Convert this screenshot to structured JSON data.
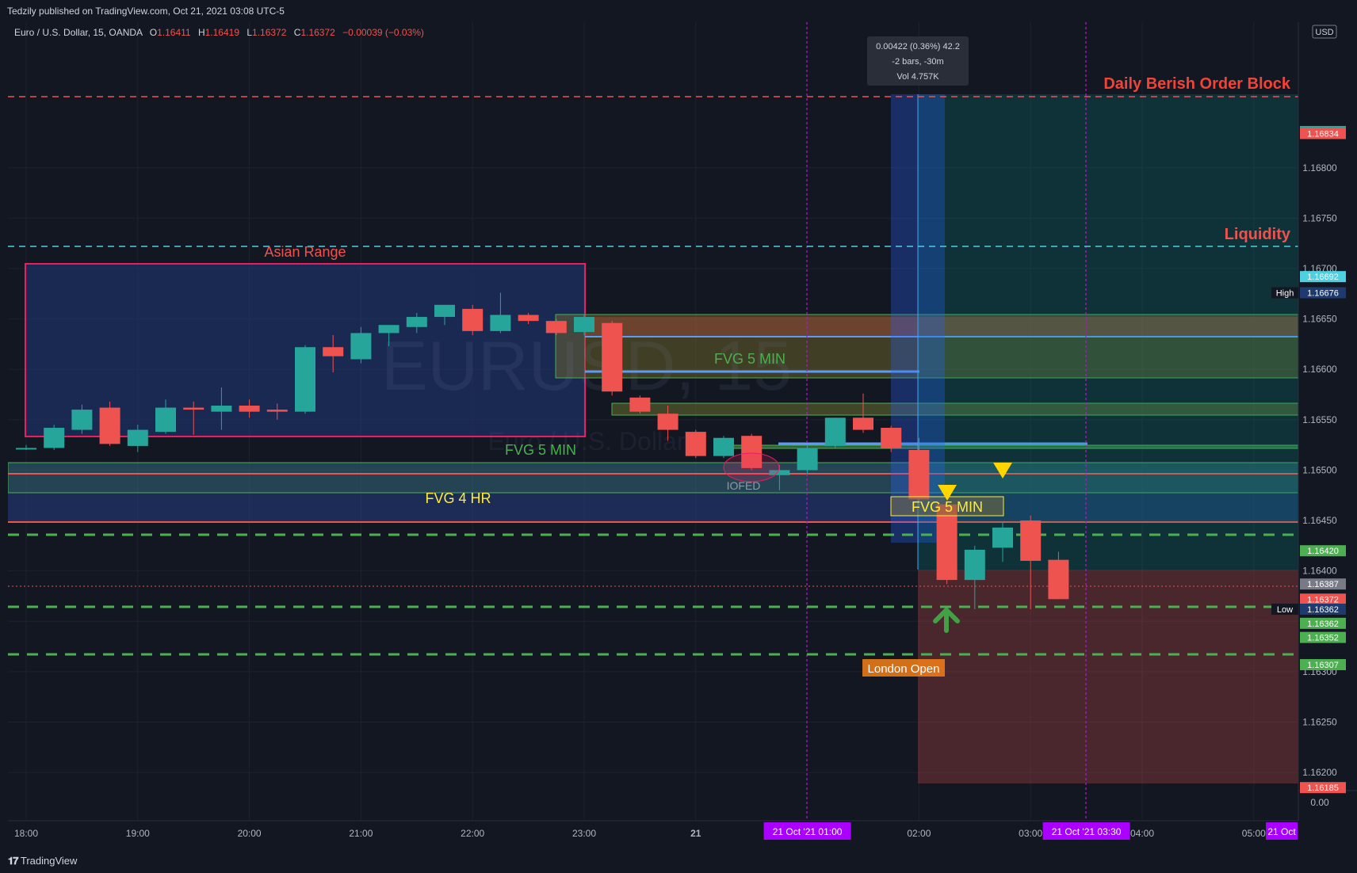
{
  "header": {
    "publish_text": "Tedzily published on TradingView.com, Oct 21, 2021 03:08 UTC-5"
  },
  "footer": {
    "brand": "TradingView"
  },
  "legend": {
    "symbol": "Euro / U.S. Dollar, 15, OANDA",
    "o_label": "O",
    "o_value": "1.16411",
    "h_label": "H",
    "h_value": "1.16419",
    "l_label": "L",
    "l_value": "1.16372",
    "c_label": "C",
    "c_value": "1.16372",
    "change": "−0.00039 (−0.03%)"
  },
  "watermark": "EURUSD, 15",
  "watermark_sub": "Euro / U.S. Dollar",
  "colors": {
    "bull": "#26a69a",
    "bear": "#ef5350",
    "background": "#131722"
  },
  "chart_data": {
    "type": "candlestick",
    "symbol": "EURUSD",
    "timeframe": "15",
    "currency": "USD",
    "ylim": [
      1.1616,
      1.1688
    ],
    "y_ticks": [
      "1.16800",
      "1.16750",
      "1.16700",
      "1.16650",
      "1.16600",
      "1.16550",
      "1.16500",
      "1.16450",
      "1.16400",
      "1.16350",
      "1.16300",
      "1.16250",
      "1.16200",
      "0.00"
    ],
    "x_ticks": [
      {
        "label": "18:00",
        "t": 0
      },
      {
        "label": "19:00",
        "t": 4
      },
      {
        "label": "20:00",
        "t": 8
      },
      {
        "label": "21:00",
        "t": 12
      },
      {
        "label": "22:00",
        "t": 16
      },
      {
        "label": "23:00",
        "t": 20
      },
      {
        "label": "21",
        "t": 24
      },
      {
        "label": "02:00",
        "t": 32
      },
      {
        "label": "03:00",
        "t": 36
      },
      {
        "label": "04:00",
        "t": 40
      },
      {
        "label": "05:00",
        "t": 44
      }
    ],
    "candles": [
      {
        "t": 0,
        "o": 1.16522,
        "h": 1.16525,
        "l": 1.1652,
        "c": 1.16522
      },
      {
        "t": 1,
        "o": 1.16522,
        "h": 1.16545,
        "l": 1.1652,
        "c": 1.16542
      },
      {
        "t": 2,
        "o": 1.1654,
        "h": 1.16565,
        "l": 1.16536,
        "c": 1.1656
      },
      {
        "t": 3,
        "o": 1.16562,
        "h": 1.16568,
        "l": 1.16524,
        "c": 1.16526
      },
      {
        "t": 4,
        "o": 1.16524,
        "h": 1.16545,
        "l": 1.16518,
        "c": 1.1654
      },
      {
        "t": 5,
        "o": 1.16538,
        "h": 1.1657,
        "l": 1.16536,
        "c": 1.16562
      },
      {
        "t": 6,
        "o": 1.16562,
        "h": 1.16568,
        "l": 1.16535,
        "c": 1.1656
      },
      {
        "t": 7,
        "o": 1.16558,
        "h": 1.16582,
        "l": 1.1654,
        "c": 1.16564
      },
      {
        "t": 8,
        "o": 1.16564,
        "h": 1.1657,
        "l": 1.16552,
        "c": 1.16558
      },
      {
        "t": 9,
        "o": 1.1656,
        "h": 1.16566,
        "l": 1.1655,
        "c": 1.16558
      },
      {
        "t": 10,
        "o": 1.16558,
        "h": 1.16624,
        "l": 1.16556,
        "c": 1.16622
      },
      {
        "t": 11,
        "o": 1.16622,
        "h": 1.16634,
        "l": 1.16597,
        "c": 1.16613
      },
      {
        "t": 12,
        "o": 1.1661,
        "h": 1.16642,
        "l": 1.16606,
        "c": 1.16636
      },
      {
        "t": 13,
        "o": 1.16636,
        "h": 1.16642,
        "l": 1.16623,
        "c": 1.16644
      },
      {
        "t": 14,
        "o": 1.16642,
        "h": 1.16656,
        "l": 1.16636,
        "c": 1.16652
      },
      {
        "t": 15,
        "o": 1.16652,
        "h": 1.16662,
        "l": 1.16644,
        "c": 1.16664
      },
      {
        "t": 16,
        "o": 1.1666,
        "h": 1.16664,
        "l": 1.16634,
        "c": 1.16638
      },
      {
        "t": 17,
        "o": 1.16638,
        "h": 1.16676,
        "l": 1.16636,
        "c": 1.16654
      },
      {
        "t": 18,
        "o": 1.16654,
        "h": 1.16656,
        "l": 1.16645,
        "c": 1.16648
      },
      {
        "t": 19,
        "o": 1.16648,
        "h": 1.1665,
        "l": 1.16634,
        "c": 1.16636
      },
      {
        "t": 20,
        "o": 1.16637,
        "h": 1.16654,
        "l": 1.16634,
        "c": 1.16652
      },
      {
        "t": 21,
        "o": 1.16646,
        "h": 1.16648,
        "l": 1.16574,
        "c": 1.16578
      },
      {
        "t": 22,
        "o": 1.16572,
        "h": 1.16574,
        "l": 1.16556,
        "c": 1.16558
      },
      {
        "t": 23,
        "o": 1.16556,
        "h": 1.16564,
        "l": 1.16529,
        "c": 1.1654
      },
      {
        "t": 24,
        "o": 1.16538,
        "h": 1.1654,
        "l": 1.16512,
        "c": 1.16514
      },
      {
        "t": 25,
        "o": 1.16514,
        "h": 1.16534,
        "l": 1.16512,
        "c": 1.16532
      },
      {
        "t": 26,
        "o": 1.16534,
        "h": 1.16536,
        "l": 1.165,
        "c": 1.16502
      },
      {
        "t": 27,
        "o": 1.16495,
        "h": 1.16505,
        "l": 1.1648,
        "c": 1.165
      },
      {
        "t": 28,
        "o": 1.165,
        "h": 1.16525,
        "l": 1.16496,
        "c": 1.16522
      },
      {
        "t": 29,
        "o": 1.16524,
        "h": 1.16552,
        "l": 1.16522,
        "c": 1.16552
      },
      {
        "t": 30,
        "o": 1.16552,
        "h": 1.16576,
        "l": 1.16537,
        "c": 1.1654
      },
      {
        "t": 31,
        "o": 1.16542,
        "h": 1.16544,
        "l": 1.16518,
        "c": 1.16522
      },
      {
        "t": 32,
        "o": 1.1652,
        "h": 1.16532,
        "l": 1.16465,
        "c": 1.16471
      },
      {
        "t": 33,
        "o": 1.16466,
        "h": 1.16468,
        "l": 1.16387,
        "c": 1.16391
      },
      {
        "t": 34,
        "o": 1.16391,
        "h": 1.16425,
        "l": 1.16362,
        "c": 1.16421
      },
      {
        "t": 35,
        "o": 1.16423,
        "h": 1.16448,
        "l": 1.16409,
        "c": 1.16443
      },
      {
        "t": 36,
        "o": 1.1645,
        "h": 1.16455,
        "l": 1.16362,
        "c": 1.1641
      },
      {
        "t": 37,
        "o": 1.16411,
        "h": 1.16419,
        "l": 1.16372,
        "c": 1.16372
      }
    ],
    "price_labels": [
      {
        "text": "1.16836",
        "price": 1.16836,
        "color": "#26a69a"
      },
      {
        "text": "1.16834",
        "price": 1.16834,
        "color": "#ef5350"
      },
      {
        "text": "1.16692",
        "price": 1.16692,
        "color": "#4dd0e1"
      },
      {
        "text": "1.16676",
        "price": 1.16676,
        "color": "#1e3a6e",
        "tag": "High"
      },
      {
        "text": "1.16420",
        "price": 1.1642,
        "color": "#4caf50"
      },
      {
        "text": "1.16387",
        "price": 1.16387,
        "color": "#787b86"
      },
      {
        "text": "1.16372",
        "price": 1.16372,
        "color": "#ef5350"
      },
      {
        "text": "1.16362",
        "price": 1.16362,
        "color": "#1e3a6e",
        "tag": "Low"
      },
      {
        "text": "1.16362",
        "price": 1.16348,
        "color": "#4caf50"
      },
      {
        "text": "1.16352",
        "price": 1.16334,
        "color": "#4caf50"
      },
      {
        "text": "1.16307",
        "price": 1.16307,
        "color": "#4caf50"
      },
      {
        "text": "1.16185",
        "price": 1.16185,
        "color": "#ef5350"
      }
    ],
    "time_labels": [
      {
        "text": "21 Oct '21   01:00",
        "t": 28
      },
      {
        "text": "21 Oct '21   03:30",
        "t": 38
      },
      {
        "text": "21 Oct",
        "t": 45
      }
    ],
    "annotations": {
      "asian_range": "Asian Range",
      "daily_ob": "Daily Berish Order Block",
      "liquidity": "Liquidity",
      "fvg_5min_upper": "FVG 5 MIN",
      "fvg_5min_mid": "FVG 5 MIN",
      "fvg_5min_lower": "FVG 5 MIN",
      "fvg_4hr": "FVG 4 HR",
      "iofed": "IOFED",
      "london_open": "London Open",
      "measure_line1": "0.00422 (0.36%) 42.2",
      "measure_line2": "-2 bars, -30m",
      "measure_line3": "Vol 4.757K"
    },
    "levels": {
      "daily_ob": 1.16834,
      "liquidity": 1.16692,
      "fvg_4hr_top": 1.16488,
      "fvg_4hr_bottom": 1.1643,
      "green_dashed": [
        1.1642,
        1.16352,
        1.16307
      ]
    }
  }
}
